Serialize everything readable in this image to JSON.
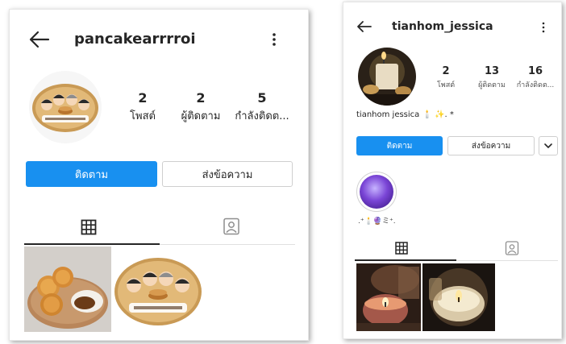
{
  "profile1": {
    "username": "pancakearrrroi",
    "stats": [
      {
        "value": "2",
        "label": "โพสต์"
      },
      {
        "value": "2",
        "label": "ผู้ติดตาม"
      },
      {
        "value": "5",
        "label": "กำลังติดต..."
      }
    ],
    "follow_label": "ติดตาม",
    "message_label": "ส่งข้อความ",
    "colors": {
      "accent": "#1890f0",
      "text": "#262626",
      "border": "#cfcfcf"
    }
  },
  "profile2": {
    "username": "tianhom_jessica",
    "stats": [
      {
        "value": "2",
        "label": "โพสต์"
      },
      {
        "value": "13",
        "label": "ผู้ติดตาม"
      },
      {
        "value": "16",
        "label": "กำลังติดต..."
      }
    ],
    "bio": "tianhom jessica 🕯️ ✨. *",
    "follow_label": "ติดตาม",
    "message_label": "ส่งข้อความ",
    "highlight": {
      "label": ".⁺🕯️🔮ミ⁺."
    },
    "colors": {
      "accent": "#1890f0",
      "text": "#262626",
      "border": "#cfcfcf"
    }
  },
  "icons": [
    "back-arrow-icon",
    "more-options-icon",
    "grid-icon",
    "tagged-icon",
    "chevron-down-icon"
  ]
}
